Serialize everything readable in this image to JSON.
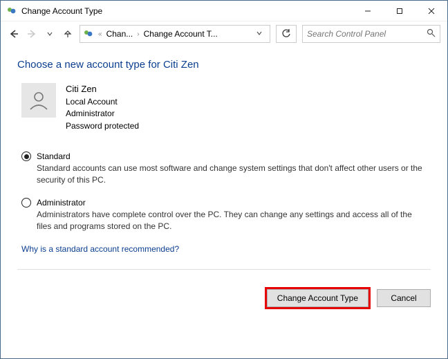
{
  "window": {
    "title": "Change Account Type"
  },
  "nav": {
    "crumb1": "Chan...",
    "crumb2": "Change Account T...",
    "search_placeholder": "Search Control Panel"
  },
  "heading": "Choose a new account type for Citi Zen",
  "user": {
    "name": "Citi Zen",
    "type": "Local Account",
    "role": "Administrator",
    "pw": "Password protected"
  },
  "options": {
    "standard": {
      "label": "Standard",
      "desc": "Standard accounts can use most software and change system settings that don't affect other users or the security of this PC."
    },
    "admin": {
      "label": "Administrator",
      "desc": "Administrators have complete control over the PC. They can change any settings and access all of the files and programs stored on the PC."
    }
  },
  "link": "Why is a standard account recommended?",
  "footer": {
    "change": "Change Account Type",
    "cancel": "Cancel"
  }
}
